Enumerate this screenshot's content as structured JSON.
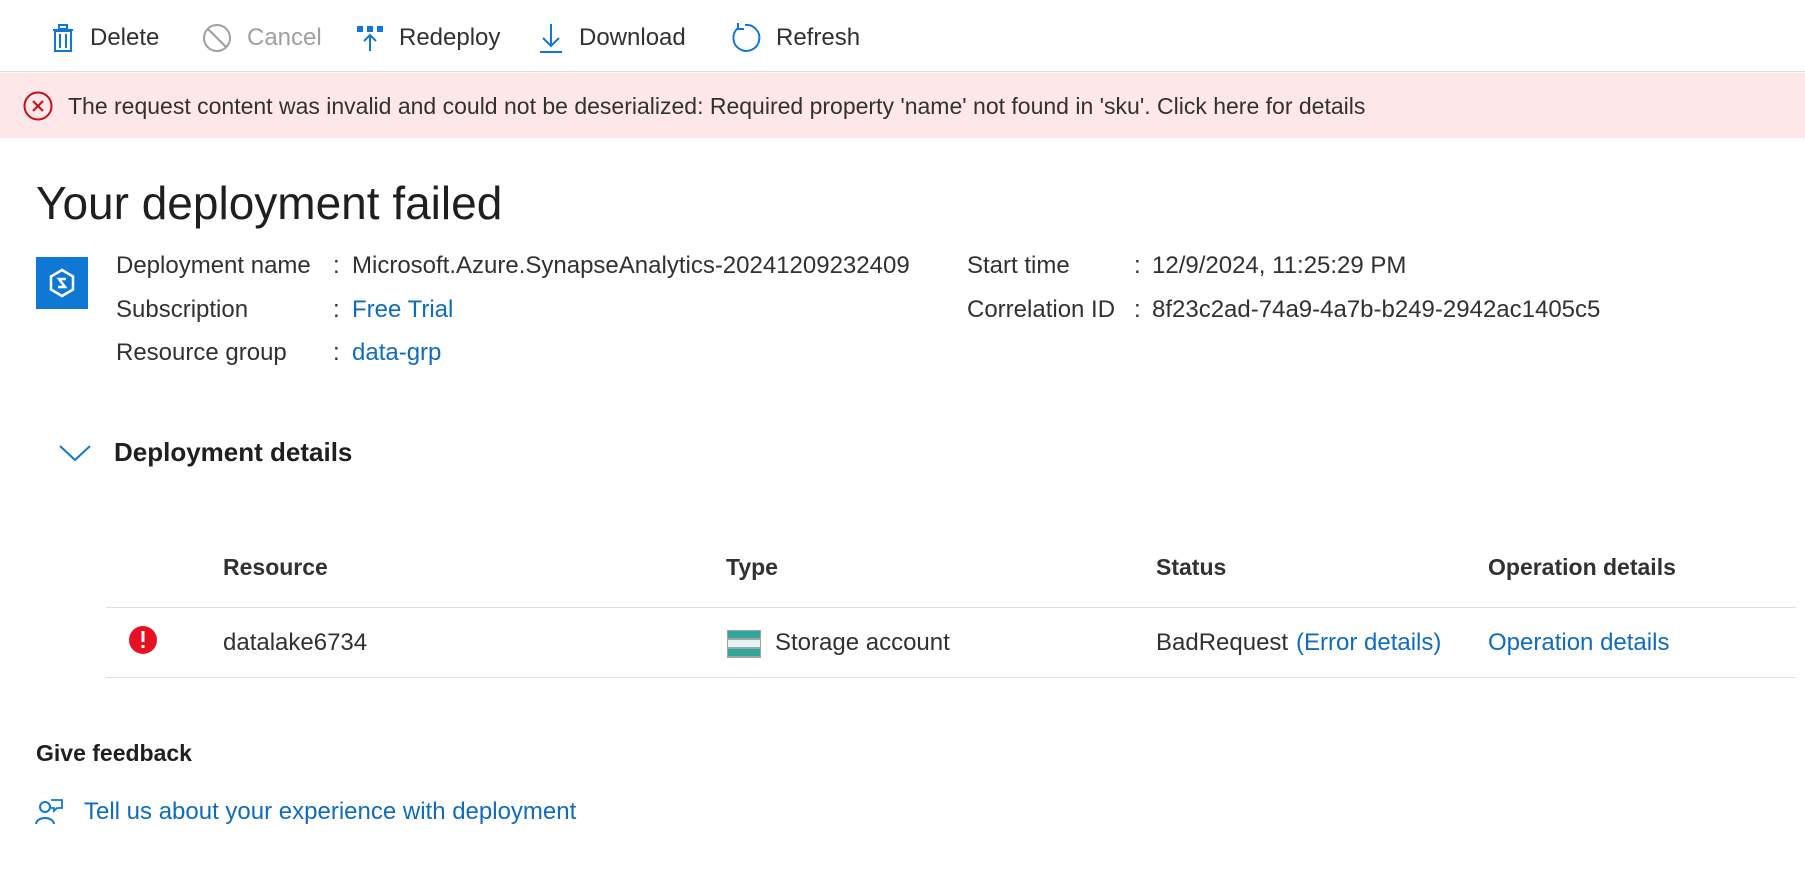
{
  "toolbar": {
    "delete_label": "Delete",
    "cancel_label": "Cancel",
    "redeploy_label": "Redeploy",
    "download_label": "Download",
    "refresh_label": "Refresh"
  },
  "error_banner": {
    "message": "The request content was invalid and could not be deserialized: Required property 'name' not found in 'sku'. Click here for details"
  },
  "page": {
    "title": "Your deployment failed"
  },
  "deployment_info": {
    "name_label": "Deployment name",
    "name_value": "Microsoft.Azure.SynapseAnalytics-20241209232409",
    "subscription_label": "Subscription",
    "subscription_value": "Free Trial",
    "resource_group_label": "Resource group",
    "resource_group_value": "data-grp",
    "start_time_label": "Start time",
    "start_time_value": "12/9/2024, 11:25:29 PM",
    "correlation_label": "Correlation ID",
    "correlation_value": "8f23c2ad-74a9-4a7b-b249-2942ac1405c5",
    "separator": ":"
  },
  "details": {
    "section_title": "Deployment details",
    "columns": [
      "Resource",
      "Type",
      "Status",
      "Operation details"
    ],
    "rows": [
      {
        "resource": "datalake6734",
        "type": "Storage account",
        "status": "BadRequest",
        "status_link": "(Error details)",
        "operation_link": "Operation details"
      }
    ]
  },
  "feedback": {
    "title": "Give feedback",
    "link_label": "Tell us about your experience with deployment"
  },
  "colors": {
    "accent": "#0f6cbd",
    "error_background": "#fde7e9",
    "error_icon": "#c50f1f",
    "resource_icon": "#0f78d4"
  }
}
